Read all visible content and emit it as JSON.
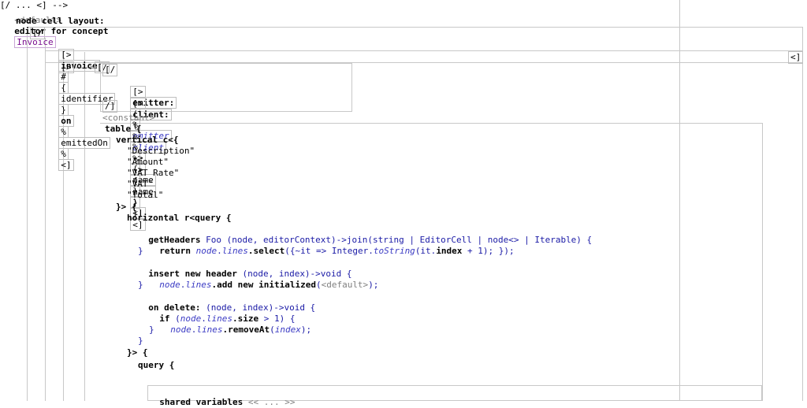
{
  "header": {
    "default_tag": "<default>",
    "editor_for_concept": "editor for concept",
    "concept_name": "Invoice",
    "node_cell_layout": "node cell layout:"
  },
  "brackets": {
    "open_vertical": "[/",
    "close_vertical": "/]",
    "open_horizontal": "[>",
    "close_horizontal": "<]",
    "dashed_arrow": "--->"
  },
  "row1": {
    "invoice": "invoice",
    "hash": "#",
    "lbrace": "{",
    "identifier": "identifier",
    "rbrace": "}",
    "on": "on",
    "pct1": "%",
    "emitted_on": "emittedOn",
    "pct2": "%"
  },
  "emitter_row": {
    "label": "emitter:",
    "lparen": "(",
    "pct1": "%",
    "ref": "emitter",
    "pct2": "%",
    "arrow": "->",
    "lbrace": "{",
    "name": "name",
    "rbrace": "}",
    "rparen": ")"
  },
  "client_row": {
    "label": "client:",
    "lparen": "(",
    "pct1": "%",
    "ref": "client",
    "pct2": "%",
    "arrow": "->",
    "lbrace": "{",
    "name": "name",
    "rbrace": "}",
    "rparen": ")"
  },
  "constant_tag": "<constant>",
  "code": {
    "table_open": "table {",
    "vertical": "vertical c<{",
    "headers": [
      "\"Description\"",
      "\"Amount\"",
      "\"VAT Rate\"",
      "\"VAT\"",
      "\"Total\""
    ],
    "vertical_close": "}> {",
    "horizontal": "horizontal r<query {",
    "get_headers_kw": "getHeaders",
    "get_headers_rest": " Foo (node, editorContext)->join(string | EditorCell | node<> | Iterable) {",
    "return_kw": "return",
    "return_node": "node",
    "return_dot1": ".",
    "return_lines": "lines",
    "return_select": ".select",
    "return_rest": "({~it => Integer.",
    "return_tostring": "toString",
    "return_rest2": "(it.",
    "return_index": "index",
    "return_rest3": " + 1); });",
    "close1": "}",
    "insert_kw": "insert new header",
    "insert_rest": " (node, index)->void {",
    "insert_node": "node",
    "insert_dot": ".",
    "insert_lines": "lines",
    "insert_add": ".add new initialized",
    "insert_rest2": "(",
    "insert_default": "<default>",
    "insert_rest3": ");",
    "close2": "}",
    "delete_kw": "on delete:",
    "delete_rest": " (node, index)->void {",
    "if_kw": "if",
    "if_rest1": " (",
    "if_node": "node",
    "if_dot": ".",
    "if_lines": "lines",
    "if_size": ".size",
    "if_rest2": " > 1) {",
    "remove_node": "node",
    "remove_dot": ".",
    "remove_lines": "lines",
    "remove_at": ".removeAt",
    "remove_rest": "(",
    "remove_index": "index",
    "remove_rest2": ");",
    "close3": "}",
    "close4": "}",
    "horizontal_close": "}> {",
    "query_open": "query {",
    "shared_vars": "shared variables",
    "shared_vars_value": "<< ... >>"
  }
}
